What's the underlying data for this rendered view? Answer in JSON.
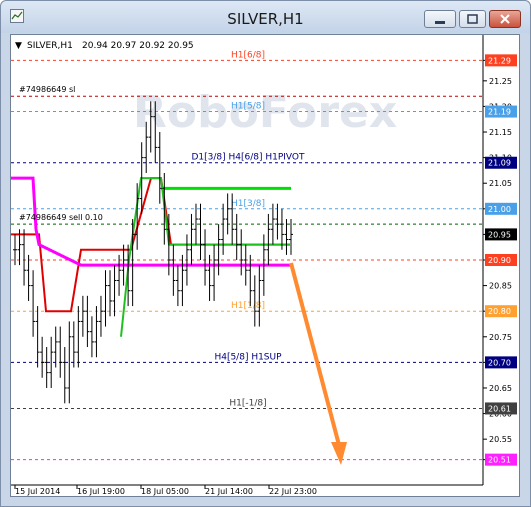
{
  "window": {
    "title": "SILVER,H1"
  },
  "header": {
    "symbol": "SILVER,H1",
    "ohlc": "20.94 20.97 20.92 20.95"
  },
  "watermark": "RoboForex",
  "price_axis": [
    "21.29",
    "21.25",
    "21.20",
    "21.15",
    "21.10",
    "21.05",
    "21.00",
    "20.95",
    "20.90",
    "20.85",
    "20.80",
    "20.75",
    "20.70",
    "20.65",
    "20.60",
    "20.55",
    "20.51"
  ],
  "price_tags": [
    {
      "text": "21.29",
      "price": 21.29,
      "color": "#ff4020"
    },
    {
      "text": "21.19",
      "price": 21.19,
      "color": "#4aa0e8"
    },
    {
      "text": "21.09",
      "price": 21.09,
      "color": "#000080"
    },
    {
      "text": "21.00",
      "price": 21.0,
      "color": "#4aa0e8"
    },
    {
      "text": "20.95",
      "price": 20.95,
      "color": "#000000"
    },
    {
      "text": "20.90",
      "price": 20.9,
      "color": "#ff4020"
    },
    {
      "text": "20.80",
      "price": 20.8,
      "color": "#ffa030"
    },
    {
      "text": "20.70",
      "price": 20.7,
      "color": "#000080"
    },
    {
      "text": "20.61",
      "price": 20.61,
      "color": "#404040"
    },
    {
      "text": "20.51",
      "price": 20.51,
      "color": "#ff20ff"
    }
  ],
  "levels": [
    {
      "label": "H1[6/8]",
      "price": 21.29,
      "color": "#ff4020",
      "labelX": 237
    },
    {
      "label": "",
      "price": 21.22,
      "color": "#c00000",
      "labelX": 0
    },
    {
      "label": "H1[5/8]",
      "price": 21.19,
      "color": "#4aa0e8",
      "labelX": 237
    },
    {
      "label": "D1[3/8] H4[6/8] H1PIVOT",
      "price": 21.09,
      "color": "#000080",
      "labelX": 237
    },
    {
      "label": "H1[3/8]",
      "price": 21.0,
      "color": "#4aa0e8",
      "labelX": 237
    },
    {
      "label": "",
      "price": 20.97,
      "color": "#006000",
      "labelX": 0
    },
    {
      "label": "",
      "price": 20.9,
      "color": "#ff4020",
      "labelX": 0
    },
    {
      "label": "H1[1/8]",
      "price": 20.8,
      "color": "#ffa030",
      "labelX": 237
    },
    {
      "label": "H4[5/8] H1SUP",
      "price": 20.7,
      "color": "#000080",
      "labelX": 237
    },
    {
      "label": "H1[-1/8]",
      "price": 20.61,
      "color": "#404040",
      "labelX": 237
    },
    {
      "label": "",
      "price": 20.51,
      "color": "#ff20ff",
      "labelX": 0
    }
  ],
  "orders": [
    {
      "text": "#74986649 sl",
      "price": 21.22
    },
    {
      "text": "#74986649 sell 0.10",
      "price": 20.97
    }
  ],
  "time_axis": [
    "15 Jul 2014",
    "16 Jul 19:00",
    "18 Jul 05:00",
    "21 Jul 14:00",
    "22 Jul 23:00"
  ],
  "chart_data": {
    "type": "bar",
    "title": "SILVER,H1",
    "ylim": [
      20.48,
      21.32
    ],
    "series": [
      {
        "name": "price",
        "values": [
          20.92,
          20.93,
          20.88,
          20.85,
          20.78,
          20.72,
          20.7,
          20.68,
          20.72,
          20.74,
          20.7,
          20.65,
          20.75,
          20.72,
          20.78,
          20.8,
          20.76,
          20.74,
          20.78,
          20.8,
          20.85,
          20.82,
          20.86,
          20.88,
          20.9,
          20.84,
          20.95,
          21.02,
          21.1,
          21.14,
          21.18,
          21.12,
          21.04,
          20.96,
          20.9,
          20.86,
          20.84,
          20.88,
          20.92,
          20.96,
          20.98,
          20.93,
          20.88,
          20.85,
          20.9,
          20.94,
          20.98,
          21.0,
          20.96,
          20.93,
          20.9,
          20.88,
          20.84,
          20.8,
          20.86,
          20.92,
          20.96,
          20.98,
          20.97,
          20.95,
          20.94,
          20.95
        ]
      }
    ]
  }
}
